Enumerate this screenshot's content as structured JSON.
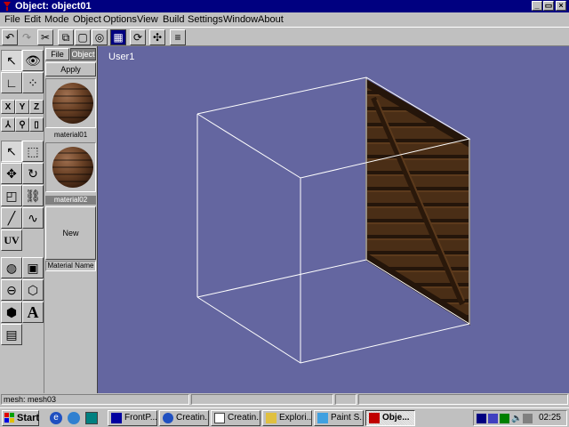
{
  "window": {
    "title": "Object: object01"
  },
  "menu": [
    "File",
    "Edit",
    "Mode",
    "Object",
    "Options",
    "View",
    "Build",
    "Settings",
    "Window",
    "About"
  ],
  "material_panel": {
    "tabs": [
      "File",
      "Object"
    ],
    "apply_label": "Apply",
    "materials": [
      "material01",
      "material02"
    ],
    "new_label": "New",
    "name_label": "Material Name"
  },
  "tools": {
    "axes": [
      "X",
      "Y",
      "Z"
    ],
    "uv_label": "UV"
  },
  "viewport": {
    "label": "User1"
  },
  "status": {
    "mesh": "mesh: mesh03"
  },
  "taskbar": {
    "start_label": "Start",
    "tasks": [
      "FrontP...",
      "Creatin...",
      "Creatin...",
      "Explori...",
      "Paint S...",
      "Obje..."
    ],
    "clock": "02:25"
  },
  "colors": {
    "viewport_bg": "#6466a0",
    "title_bg": "#000080",
    "wire": "#ffffff",
    "crate": "#4a2e16"
  }
}
